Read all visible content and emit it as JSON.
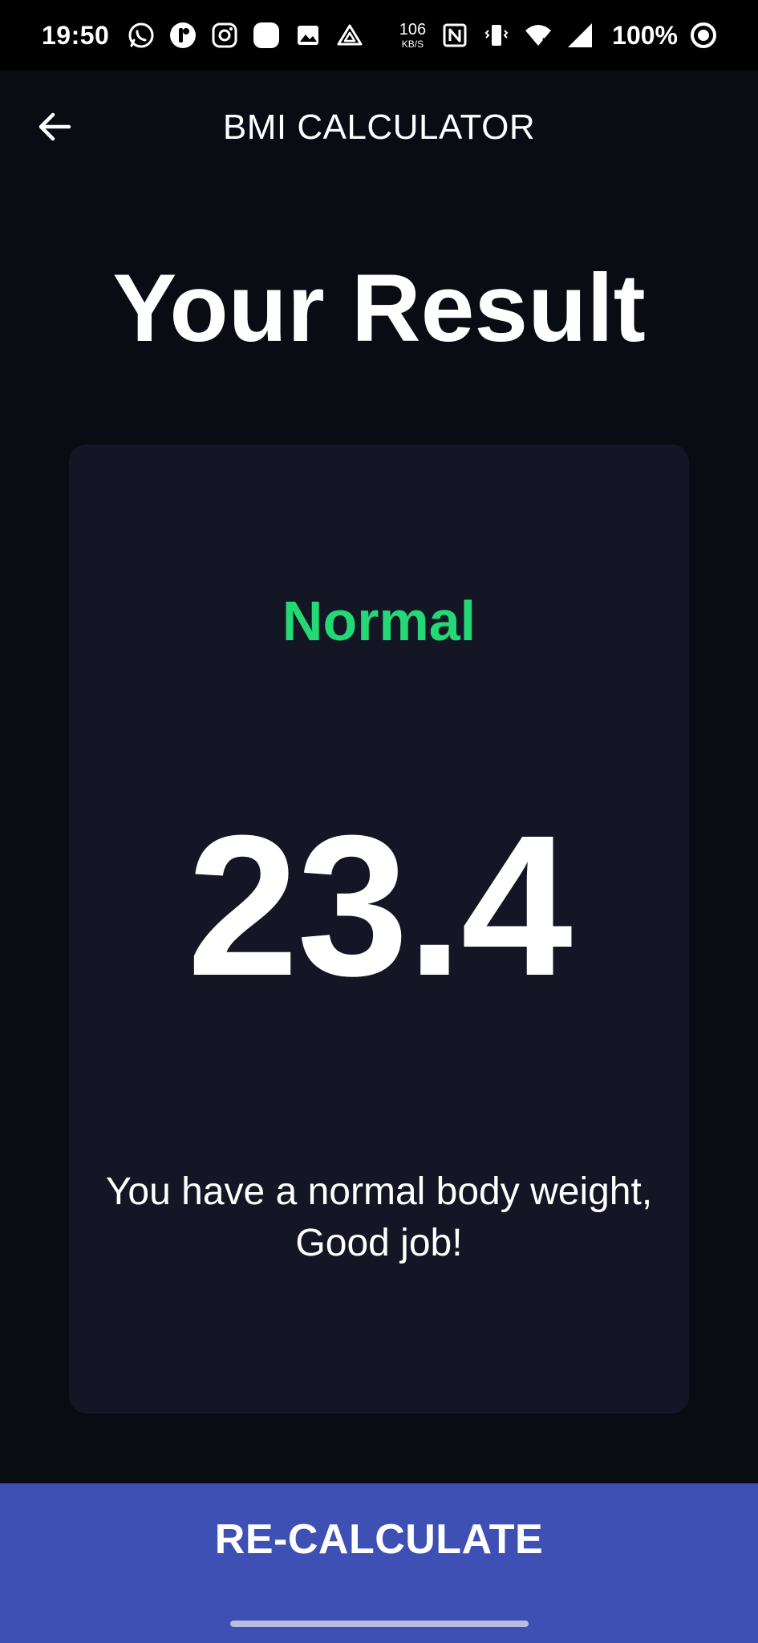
{
  "status_bar": {
    "time": "19:50",
    "net_speed_value": "106",
    "net_speed_unit": "KB/S",
    "battery_percent": "100%",
    "left_icons": [
      "whatsapp-icon",
      "app-icon",
      "instagram-icon",
      "square-app-icon",
      "gallery-icon",
      "drive-icon"
    ],
    "right_icons": [
      "nfc-icon",
      "vibrate-icon",
      "wifi-icon",
      "signal-icon",
      "ring-icon"
    ]
  },
  "app_bar": {
    "title": "BMI CALCULATOR",
    "back_icon": "arrow-left-icon"
  },
  "page": {
    "headline": "Your Result"
  },
  "result": {
    "category": "Normal",
    "category_color": "#24d876",
    "bmi": "23.4",
    "message": "You have a normal body weight, Good job!"
  },
  "actions": {
    "recalculate_label": "RE-CALCULATE",
    "button_color": "#3e50b4"
  }
}
